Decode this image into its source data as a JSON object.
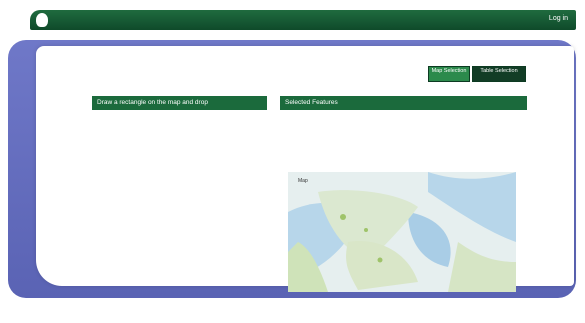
{
  "header": {
    "login_label": "Log in"
  },
  "buttons": {
    "first_label": "Map Selection",
    "second_label": "Table Selection"
  },
  "sections": {
    "left_title": "Draw a rectangle on the map and drop",
    "right_title": "Selected Features"
  },
  "map": {
    "label": "Map"
  },
  "colors": {
    "brand_green": "#1b6a3c",
    "frame_blue": "#6f78c8"
  }
}
